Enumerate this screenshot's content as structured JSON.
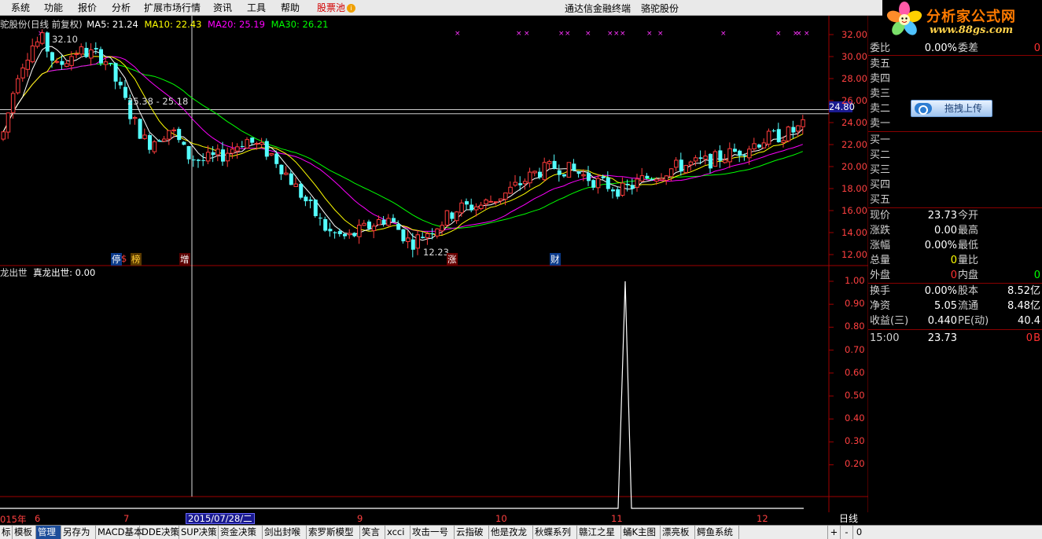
{
  "menu": {
    "items": [
      "系统",
      "功能",
      "报价",
      "分析",
      "扩展市场行情",
      "资讯",
      "工具",
      "帮助"
    ],
    "pool": "股票池",
    "app_title": "通达信金融终端",
    "stock_name": "骆驼股份"
  },
  "logo": {
    "title": "分析家公式网",
    "url_text": "www.88gs.com"
  },
  "chart": {
    "header": "驼股份(日线 前复权)",
    "ma5": "MA5: 21.24",
    "ma10": "MA10: 22.43",
    "ma20": "MA20: 25.19",
    "ma30": "MA30: 26.21",
    "high_label": "32.10",
    "low_label": "12.23",
    "level_label": "25.38 - 25.18",
    "price_marker": "24.80",
    "price_axis": [
      "32.00",
      "30.00",
      "28.00",
      "26.00",
      "24.00",
      "22.00",
      "20.00",
      "18.00",
      "16.00",
      "14.00",
      "12.00"
    ],
    "event_tags": [
      "停",
      "$",
      "榜",
      "增",
      "涨",
      "财"
    ],
    "colors": {
      "up": "#ff3c3c",
      "down": "#54ffff",
      "ma5": "#ffffff",
      "ma10": "#ffff00",
      "ma20": "#ff00ff",
      "ma30": "#00ff00",
      "axis": "#a00000"
    }
  },
  "indicator": {
    "header": "龙出世",
    "series_label": "真龙出世: 0.00",
    "axis": [
      "1.00",
      "0.90",
      "0.80",
      "0.70",
      "0.60",
      "0.50",
      "0.40",
      "0.30",
      "0.20"
    ],
    "chart_data": {
      "type": "line",
      "series": [
        {
          "name": "真龙出世",
          "spike_value": 1.0,
          "baseline_value": 0.0
        }
      ],
      "ylim": [
        0,
        1.05
      ]
    }
  },
  "dates": {
    "labels": [
      "015年",
      "6",
      "7",
      "9",
      "10",
      "11",
      "12"
    ],
    "cursor": "2015/07/28/二",
    "period": "日线"
  },
  "quote": {
    "weibi_label": "委比",
    "weibi_value": "0.00%",
    "weicha_label": "委差",
    "weicha_value": "0",
    "sell": [
      "卖五",
      "卖四",
      "卖三",
      "卖二",
      "卖一"
    ],
    "buy": [
      "买一",
      "买二",
      "买三",
      "买四",
      "买五"
    ],
    "rows": [
      {
        "l1": "现价",
        "v1": "23.73",
        "l2": "今开",
        "v2": ""
      },
      {
        "l1": "涨跌",
        "v1": "0.00",
        "l2": "最高",
        "v2": ""
      },
      {
        "l1": "涨幅",
        "v1": "0.00%",
        "l2": "最低",
        "v2": ""
      },
      {
        "l1": "总量",
        "v1": "0",
        "l2": "量比",
        "v2": ""
      },
      {
        "l1": "外盘",
        "v1": "0",
        "l2": "内盘",
        "v2": "0"
      },
      {
        "l1": "换手",
        "v1": "0.00%",
        "l2": "股本",
        "v2": "8.52亿"
      },
      {
        "l1": "净资",
        "v1": "5.05",
        "l2": "流通",
        "v2": "8.48亿"
      },
      {
        "l1": "收益(三)",
        "v1": "0.440",
        "l2": "PE(动)",
        "v2": "40.4"
      }
    ],
    "tick": {
      "time": "15:00",
      "price": "23.73",
      "vol": "0",
      "side": "B"
    },
    "upload_button": "拖拽上传"
  },
  "tabs": [
    "标",
    "模板",
    "管理",
    "另存为",
    "MACD基本",
    "DDE决策",
    "SUP决策",
    "资金决策",
    "剑出封喉",
    "索罗斯模型",
    "笑言",
    "xcci",
    "攻击一号",
    "云指破",
    "他是孜龙",
    "秋蝶系列",
    "赣江之星",
    "蛹K主图",
    "漂亮板",
    "鳄鱼系统"
  ],
  "tab_controls": [
    "+",
    "-",
    "0"
  ]
}
